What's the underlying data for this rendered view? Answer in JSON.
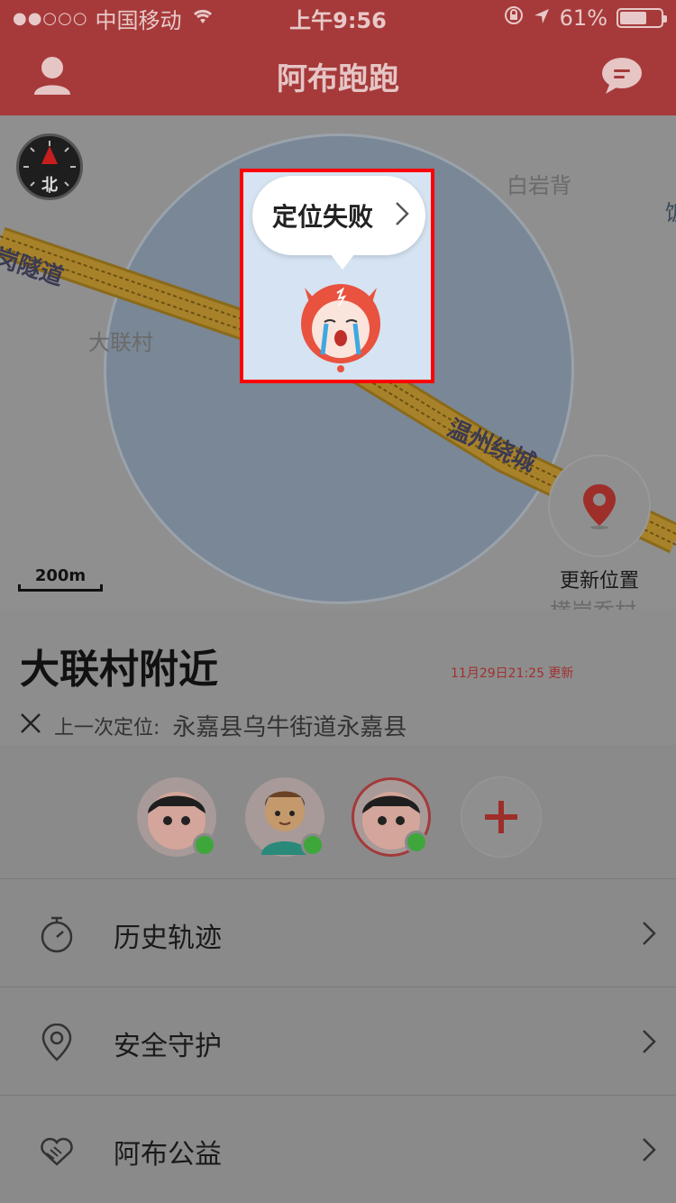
{
  "status_bar": {
    "signal": "●●○○○",
    "carrier": "中国移动",
    "time": "上午9:56",
    "battery_percent": "61%"
  },
  "nav": {
    "title": "阿布跑跑"
  },
  "map": {
    "labels": {
      "baiyanbei": "白岩背",
      "dalian_village": "大联村",
      "tunnel": "岗隧道",
      "wenzhou_ring": "温州绕城",
      "hengang_village": "横岗乔村",
      "edge": "饭"
    },
    "scale": "200m",
    "compass_label": "北"
  },
  "popup": {
    "text": "定位失败"
  },
  "update_button": {
    "label": "更新位置"
  },
  "location": {
    "title": "大联村附近",
    "updated": "11月29日21:25 更新",
    "last_prefix": "上一次定位:",
    "last_address": "永嘉县乌牛街道永嘉县"
  },
  "menu": {
    "items": [
      {
        "label": "历史轨迹",
        "icon": "stopwatch-icon"
      },
      {
        "label": "安全守护",
        "icon": "location-pin-icon"
      },
      {
        "label": "阿布公益",
        "icon": "heart-hands-icon"
      }
    ]
  },
  "colors": {
    "brand_red": "#a63a3a",
    "online_green": "#3fa63b",
    "highlight": "#ff0000"
  }
}
